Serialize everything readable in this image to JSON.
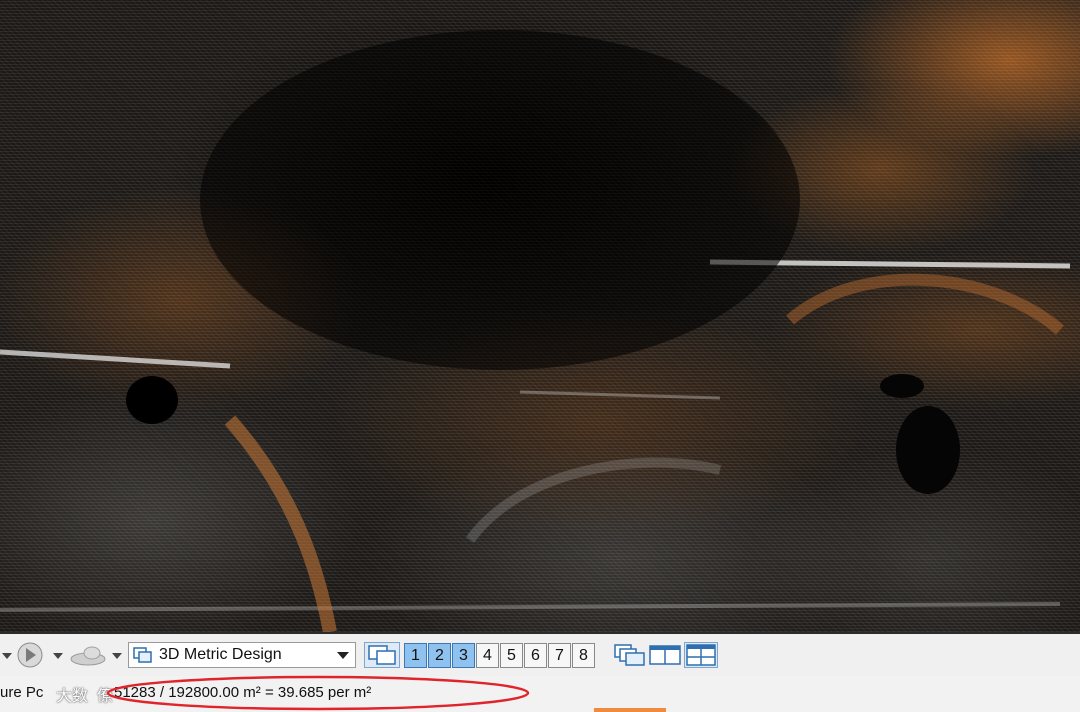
{
  "toolbar": {
    "design_model_label": "3D Metric Design",
    "view_numbers": [
      "1",
      "2",
      "3",
      "4",
      "5",
      "6",
      "7",
      "8"
    ],
    "active_views": [
      "1",
      "2",
      "3"
    ],
    "icons": [
      "back-icon",
      "forward-icon",
      "shape-icon",
      "view-group-icon",
      "copy-view-icon",
      "split-horizontal-icon",
      "tile-views-icon"
    ]
  },
  "status": {
    "prompt_fragment": "ure Pc",
    "watermark": "大数  僚",
    "readout": "51283 / 192800.00 m² = 39.685 per m²"
  },
  "colors": {
    "annotation": "#e0242c",
    "active_view": "#8fc2ee",
    "point_orange": "#c8742e"
  }
}
